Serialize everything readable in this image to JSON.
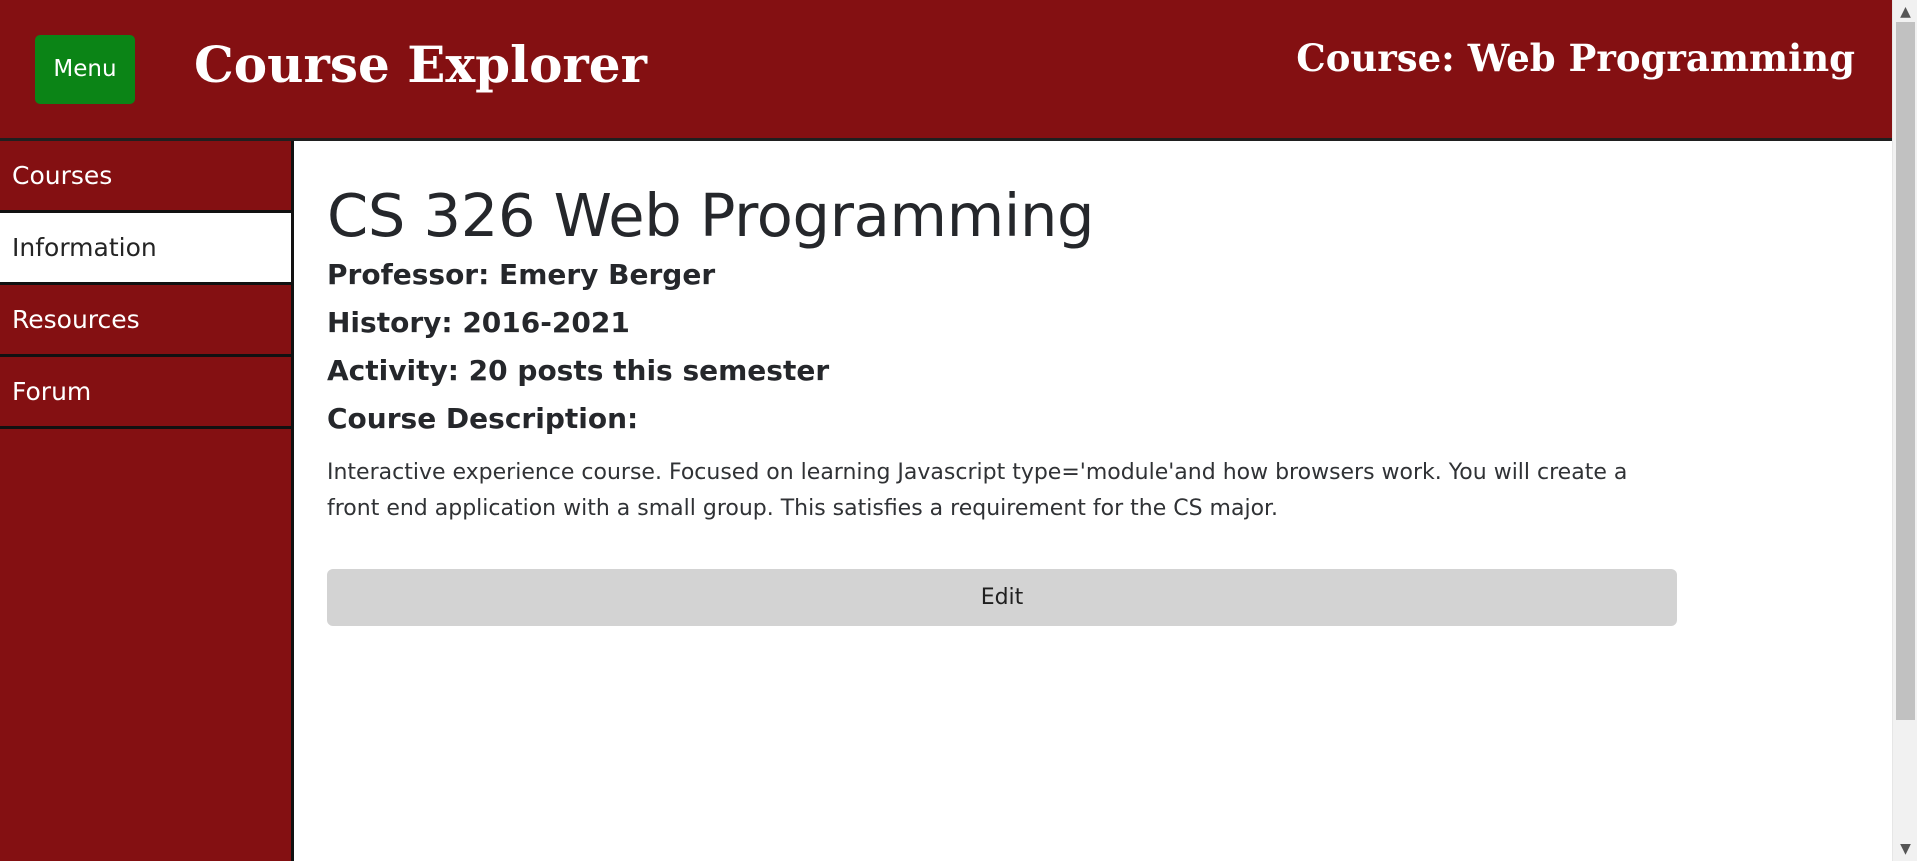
{
  "header": {
    "menu_label": "Menu",
    "app_title": "Course Explorer",
    "course_title": "Course: Web Programming"
  },
  "sidebar": {
    "items": [
      {
        "label": "Courses",
        "active": false
      },
      {
        "label": "Information",
        "active": true
      },
      {
        "label": "Resources",
        "active": false
      },
      {
        "label": "Forum",
        "active": false
      }
    ]
  },
  "course": {
    "title": "CS 326 Web Programming",
    "professor": "Professor: Emery Berger",
    "history": "History: 2016-2021",
    "activity": "Activity: 20 posts this semester",
    "description_heading": "Course Description:",
    "description": "Interactive experience course. Focused on learning Javascript type='module'and how browsers work. You will create a front end application with a small group. This satisfies a requirement for the CS major.",
    "edit_label": "Edit"
  },
  "scrollbar": {
    "up_icon": "▲",
    "down_icon": "▼"
  },
  "colors": {
    "brand": "#841012",
    "menu_button": "#0b8416",
    "edit_button": "#d3d3d3",
    "text": "#25272b"
  }
}
